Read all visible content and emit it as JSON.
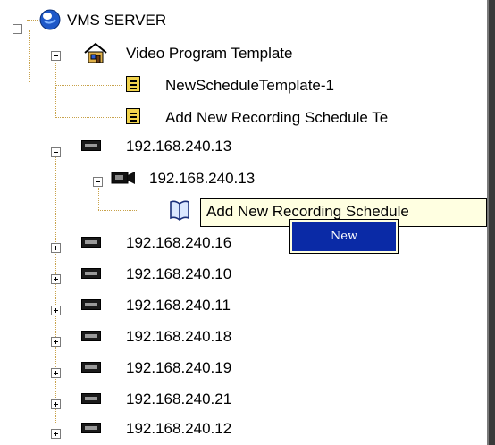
{
  "tree": {
    "root": {
      "label": "VMS SERVER",
      "icon": "globe-icon",
      "state": "expanded"
    },
    "template_group": {
      "label": "Video Program Template",
      "icon": "house-icon",
      "items": [
        {
          "label": "NewScheduleTemplate-1",
          "icon": "schedule-document-icon"
        },
        {
          "label": "Add New Recording Schedule Te",
          "icon": "schedule-document-icon"
        }
      ]
    },
    "expanded_server": {
      "label": "192.168.240.13",
      "icon": "server-icon",
      "camera": {
        "label": "192.168.240.13",
        "icon": "camera-icon",
        "child": {
          "label": "Add New Recording Schedule",
          "icon": "book-icon"
        }
      }
    },
    "collapsed_servers": [
      {
        "label": "192.168.240.16",
        "icon": "server-icon"
      },
      {
        "label": "192.168.240.10",
        "icon": "server-icon"
      },
      {
        "label": "192.168.240.11",
        "icon": "server-icon"
      },
      {
        "label": "192.168.240.18",
        "icon": "server-icon"
      },
      {
        "label": "192.168.240.19",
        "icon": "server-icon"
      },
      {
        "label": "192.168.240.21",
        "icon": "server-icon"
      },
      {
        "label": "192.168.240.12",
        "icon": "server-icon"
      }
    ]
  },
  "tooltip": {
    "text": "Add New Recording Schedule"
  },
  "context_menu": {
    "items": [
      {
        "label": "New"
      }
    ]
  },
  "colors": {
    "tooltip_bg": "#ffffe1",
    "menu_highlight": "#0a2aa6",
    "connector": "#c8a24a",
    "doc_icon": "#f1d34c"
  }
}
